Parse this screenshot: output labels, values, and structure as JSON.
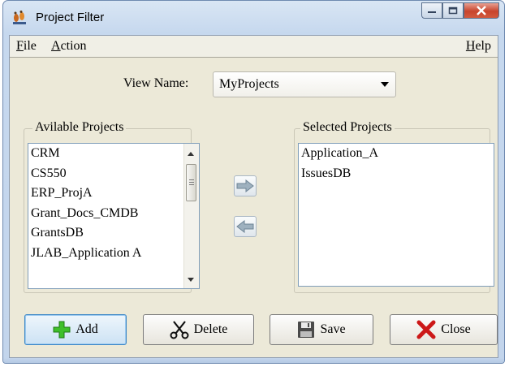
{
  "window": {
    "title": "Project Filter",
    "app_icon": "footprints-app-icon",
    "controls": [
      "minimize-icon",
      "maximize-icon",
      "close-icon"
    ]
  },
  "menu": {
    "file": {
      "accel": "F",
      "rest": "ile"
    },
    "action": {
      "accel": "A",
      "rest": "ction"
    },
    "help": {
      "accel": "H",
      "rest": "elp"
    }
  },
  "view": {
    "label": "View Name:",
    "selected": "MyProjects"
  },
  "available": {
    "label": "Avilable Projects",
    "items": [
      "CRM",
      "CS550",
      "ERP_ProjA",
      "Grant_Docs_CMDB",
      "GrantsDB",
      "JLAB_Application A"
    ]
  },
  "selected": {
    "label": "Selected Projects",
    "items": [
      "Application_A",
      "IssuesDB"
    ]
  },
  "buttons": {
    "add": "Add",
    "delete": "Delete",
    "save": "Save",
    "close": "Close"
  },
  "icons": {
    "add": "green-plus-icon",
    "delete": "scissors-icon",
    "save": "floppy-disk-icon",
    "close": "red-x-icon",
    "move_right": "arrow-right-icon",
    "move_left": "arrow-left-icon"
  },
  "colors": {
    "add_icon": "#3fbf2a",
    "close_icon": "#cc1818",
    "arrow_fill": "#9eb1bf"
  }
}
